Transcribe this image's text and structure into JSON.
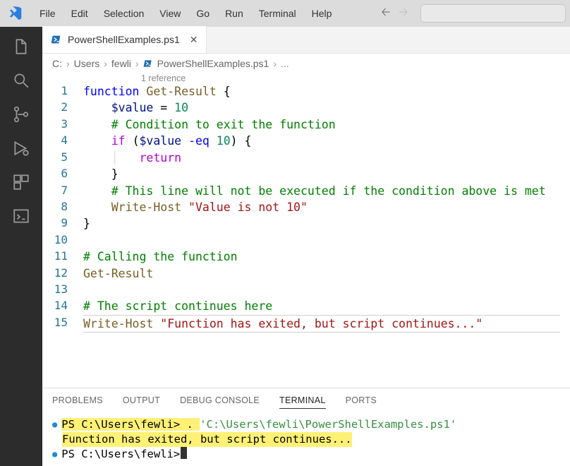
{
  "menu": {
    "items": [
      "File",
      "Edit",
      "Selection",
      "View",
      "Go",
      "Run",
      "Terminal",
      "Help"
    ]
  },
  "tab": {
    "filename": "PowerShellExamples.ps1"
  },
  "breadcrumb": {
    "parts": [
      "C:",
      "Users",
      "fewli"
    ],
    "file": "PowerShellExamples.ps1",
    "trailing": "..."
  },
  "codelens": "1 reference",
  "code": {
    "lines": [
      {
        "n": 1,
        "html": "<span class='tok-kw'>function</span> <span class='tok-fn'>Get-Result</span> <span class='tok-punct'>{</span>"
      },
      {
        "n": 2,
        "html": "    <span class='tok-var'>$value</span> <span class='tok-op'>=</span> <span class='tok-num'>10</span>"
      },
      {
        "n": 3,
        "html": "    <span class='tok-cmt'># Condition to exit the function</span>"
      },
      {
        "n": 4,
        "html": "    <span class='tok-ret'>if</span> <span class='tok-punct'>(</span><span class='tok-var'>$value</span> <span class='tok-kw'>-eq</span> <span class='tok-num'>10</span><span class='tok-punct'>)</span> <span class='tok-punct'>{</span>"
      },
      {
        "n": 5,
        "html": "    <span class='indent-guide'>│   </span><span class='tok-ret'>return</span>"
      },
      {
        "n": 6,
        "html": "    <span class='tok-punct'>}</span>"
      },
      {
        "n": 7,
        "html": "    <span class='tok-cmt'># This line will not be executed if the condition above is met</span>"
      },
      {
        "n": 8,
        "html": "    <span class='tok-fn'>Write-Host</span> <span class='tok-str'>\"Value is not 10\"</span>"
      },
      {
        "n": 9,
        "html": "<span class='tok-punct'>}</span>"
      },
      {
        "n": 10,
        "html": ""
      },
      {
        "n": 11,
        "html": "<span class='tok-cmt'># Calling the function</span>"
      },
      {
        "n": 12,
        "html": "<span class='tok-fn'>Get-Result</span>"
      },
      {
        "n": 13,
        "html": ""
      },
      {
        "n": 14,
        "html": "<span class='tok-cmt'># The script continues here</span>"
      },
      {
        "n": 15,
        "html": "<span class='tok-fn'>Write-Host</span> <span class='tok-str'>\"Function has exited, but script continues...\"</span>",
        "cursor": true
      }
    ]
  },
  "panel": {
    "tabs": [
      "PROBLEMS",
      "OUTPUT",
      "DEBUG CONSOLE",
      "TERMINAL",
      "PORTS"
    ],
    "active": "TERMINAL"
  },
  "terminal": {
    "prompt1_prefix": "PS C:\\Users\\fewli> ",
    "prompt1_cmd_dot": ". ",
    "prompt1_cmd_path": "'C:\\Users\\fewli\\PowerShellExamples.ps1'",
    "output_line": "Function has exited, but script continues...",
    "prompt2_prefix": "PS C:\\Users\\fewli> "
  }
}
